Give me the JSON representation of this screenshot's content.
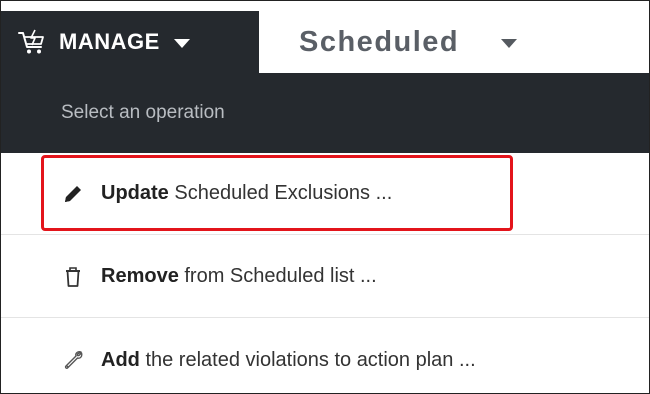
{
  "header": {
    "manage_label": "MANAGE",
    "cart_icon": "cart-icon",
    "scheduled_label": "Scheduled"
  },
  "operation_prompt": "Select an operation",
  "menu": {
    "items": [
      {
        "icon": "pencil-icon",
        "action": "Update",
        "rest": " Scheduled Exclusions ..."
      },
      {
        "icon": "trash-icon",
        "action": "Remove",
        "rest": " from Scheduled list ..."
      },
      {
        "icon": "wrench-icon",
        "action": "Add",
        "rest": " the related violations to action plan ..."
      }
    ]
  },
  "colors": {
    "dark_bar": "#25292e",
    "highlight": "#e3141b",
    "tab_text": "#5a5f66"
  }
}
